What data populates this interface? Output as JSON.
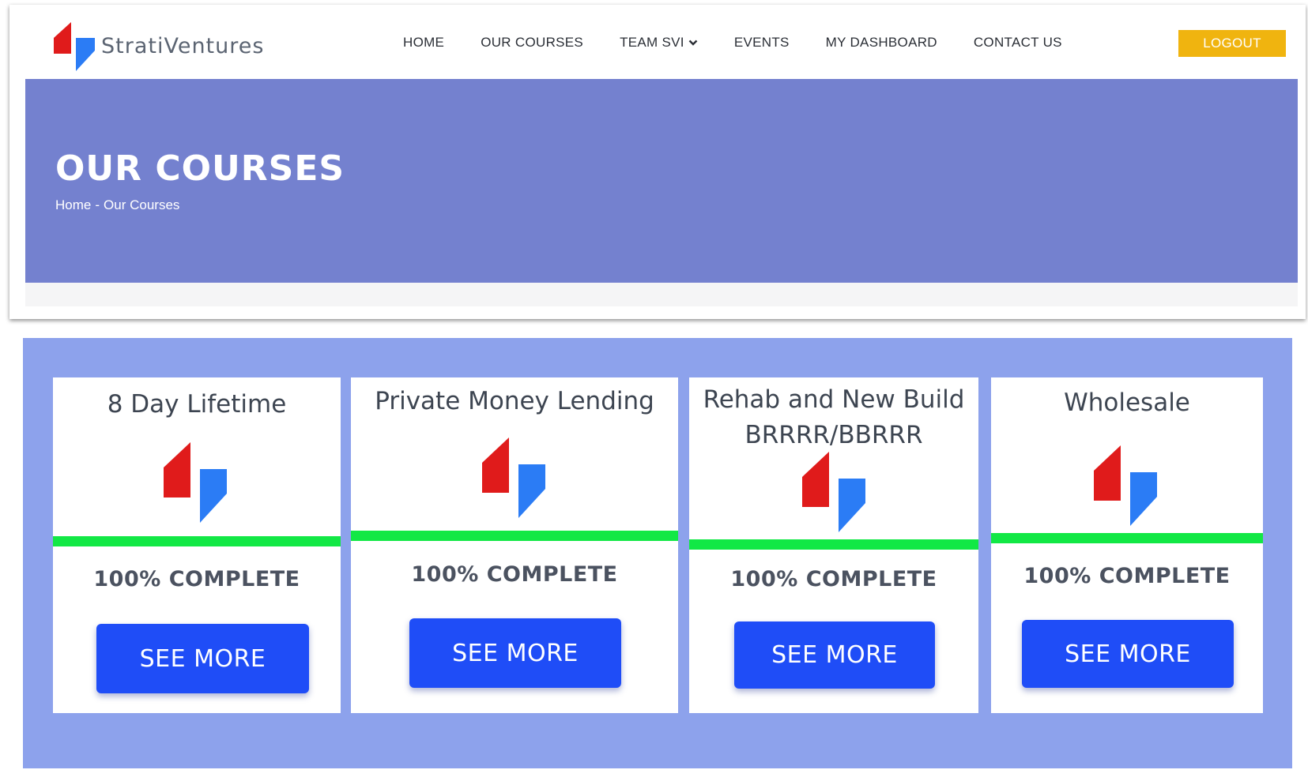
{
  "brand": {
    "name": "StratiVentures",
    "logo_icon": "strati-logo-icon",
    "red": "#e01b1b",
    "blue": "#2b7cf5"
  },
  "nav": {
    "items": [
      {
        "label": "HOME"
      },
      {
        "label": "OUR COURSES"
      },
      {
        "label": "TEAM SVI",
        "icon": "chevron-down-icon"
      },
      {
        "label": "EVENTS"
      },
      {
        "label": "MY DASHBOARD"
      },
      {
        "label": "CONTACT US"
      }
    ],
    "logout_label": "LOGOUT"
  },
  "hero": {
    "title": "OUR COURSES",
    "breadcrumb": {
      "home": "Home",
      "separator": "-",
      "current": "Our Courses"
    }
  },
  "colors": {
    "hero_bg": "#7481cf",
    "section_bg": "#8da2ec",
    "progress": "#12e845",
    "button": "#1f4df7",
    "logout": "#f0b40f"
  },
  "courses": [
    {
      "title_lines": [
        "8 Day Lifetime"
      ],
      "progress_percent": 100,
      "progress_label": "100% COMPLETE",
      "button_label": "SEE MORE"
    },
    {
      "title_lines": [
        "Private Money Lending"
      ],
      "progress_percent": 100,
      "progress_label": "100% COMPLETE",
      "button_label": "SEE MORE"
    },
    {
      "title_lines": [
        "Rehab and New Build",
        "BRRRR/BBRRR"
      ],
      "progress_percent": 100,
      "progress_label": "100% COMPLETE",
      "button_label": "SEE MORE"
    },
    {
      "title_lines": [
        "Wholesale"
      ],
      "progress_percent": 100,
      "progress_label": "100% COMPLETE",
      "button_label": "SEE MORE"
    }
  ]
}
